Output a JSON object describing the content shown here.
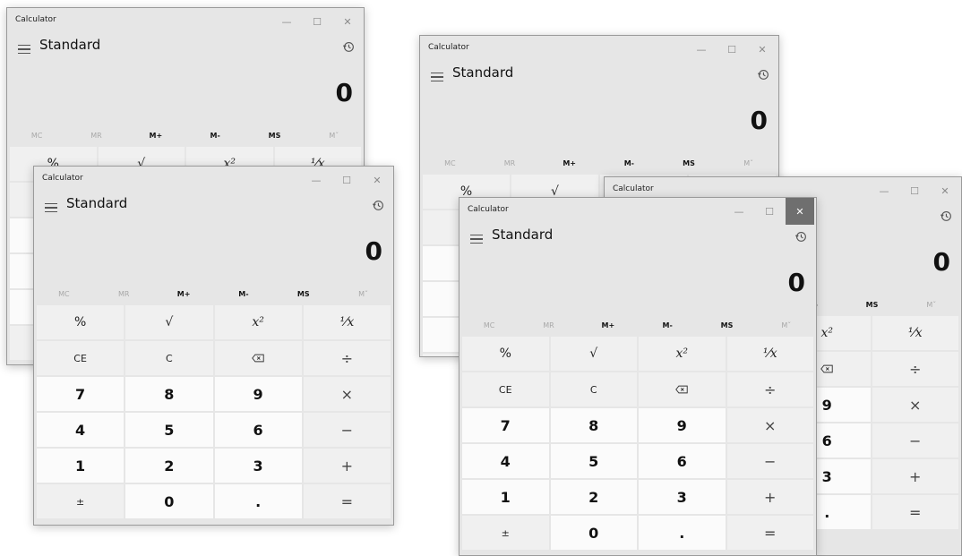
{
  "app": {
    "title": "Calculator",
    "mode": "Standard",
    "display_value": "0"
  },
  "window_controls": {
    "minimize": "—",
    "maximize": "☐",
    "close": "✕"
  },
  "memory": [
    "MC",
    "MR",
    "M+",
    "M-",
    "MS",
    "Mˇ"
  ],
  "keypad": [
    {
      "label": "%",
      "kind": "fn"
    },
    {
      "label": "√",
      "kind": "fn"
    },
    {
      "label": "x²",
      "kind": "fn-italic"
    },
    {
      "label": "⅟x",
      "kind": "fn-italic"
    },
    {
      "label": "CE",
      "kind": "fn-small"
    },
    {
      "label": "C",
      "kind": "fn-small"
    },
    {
      "label": "⌫",
      "kind": "fn"
    },
    {
      "label": "÷",
      "kind": "op"
    },
    {
      "label": "7",
      "kind": "num"
    },
    {
      "label": "8",
      "kind": "num"
    },
    {
      "label": "9",
      "kind": "num"
    },
    {
      "label": "×",
      "kind": "op"
    },
    {
      "label": "4",
      "kind": "num"
    },
    {
      "label": "5",
      "kind": "num"
    },
    {
      "label": "6",
      "kind": "num"
    },
    {
      "label": "−",
      "kind": "op"
    },
    {
      "label": "1",
      "kind": "num"
    },
    {
      "label": "2",
      "kind": "num"
    },
    {
      "label": "3",
      "kind": "num"
    },
    {
      "label": "+",
      "kind": "op"
    },
    {
      "label": "±",
      "kind": "fn-small"
    },
    {
      "label": "0",
      "kind": "num"
    },
    {
      "label": ".",
      "kind": "num"
    },
    {
      "label": "=",
      "kind": "op"
    }
  ],
  "colors": {
    "window_bg": "#e6e6e6",
    "fn_key": "#f0f0f0",
    "num_key": "#fbfbfb",
    "close_hover": "#6f6f6f"
  },
  "icons": {
    "menu": "hamburger-icon",
    "history": "history-icon",
    "backspace": "backspace-icon"
  }
}
